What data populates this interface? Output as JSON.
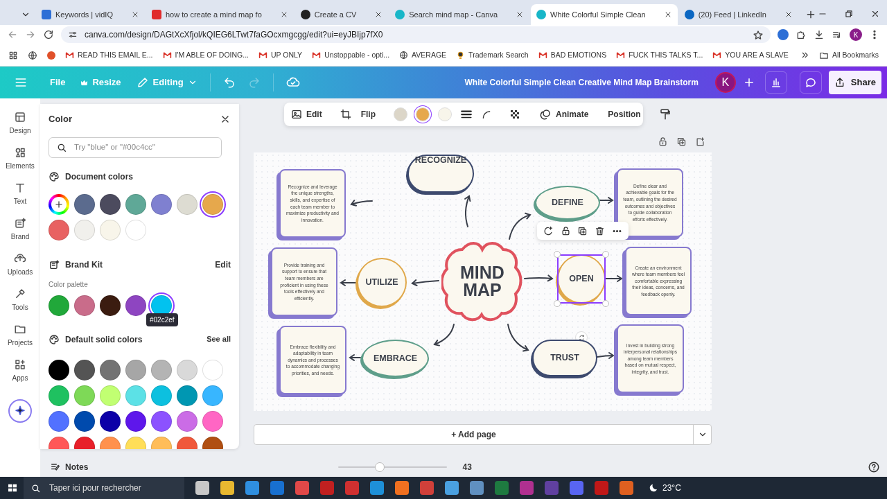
{
  "browser": {
    "tabs": [
      {
        "title": "Keywords | vidIQ",
        "selected": false
      },
      {
        "title": "how to create a mind map fo",
        "selected": false
      },
      {
        "title": "Create a CV",
        "selected": false
      },
      {
        "title": "Search mind map - Canva",
        "selected": false
      },
      {
        "title": "White Colorful Simple Clean",
        "selected": true
      },
      {
        "title": "(20) Feed | LinkedIn",
        "selected": false
      }
    ],
    "address": "canva.com/design/DAGtXcXfjol/kQIEG6LTwt7faGOcxmgcgg/edit?ui=eyJBIjp7fX0",
    "profile": "K",
    "bookmarks": [
      {
        "label": "READ THIS EMAIL E...",
        "kind": "mail"
      },
      {
        "label": "I'M ABLE OF DOING...",
        "kind": "mail"
      },
      {
        "label": "UP ONLY",
        "kind": "mail"
      },
      {
        "label": "Unstoppable - opti...",
        "kind": "mail"
      },
      {
        "label": "AVERAGE",
        "kind": "globe"
      },
      {
        "label": "Trademark Search",
        "kind": "bulb"
      },
      {
        "label": "BAD EMOTIONS",
        "kind": "mail"
      },
      {
        "label": "FUCK THIS TALKS T...",
        "kind": "mail"
      },
      {
        "label": "YOU ARE A SLAVE",
        "kind": "mail"
      }
    ],
    "all_bookmarks": "All Bookmarks"
  },
  "header": {
    "menu": [
      {
        "label": "File",
        "kind": "text"
      },
      {
        "label": "Resize",
        "kind": "crown"
      },
      {
        "label": "Editing",
        "kind": "pencil"
      }
    ],
    "redo_disabled": true,
    "title": "White Colorful Simple Clean Creative Mind Map Brainstorm",
    "avatar": "K",
    "share": "Share"
  },
  "sidebar": {
    "items": [
      {
        "label": "Design"
      },
      {
        "label": "Elements"
      },
      {
        "label": "Text"
      },
      {
        "label": "Brand"
      },
      {
        "label": "Uploads"
      },
      {
        "label": "Tools"
      },
      {
        "label": "Projects"
      },
      {
        "label": "Apps"
      }
    ]
  },
  "color_panel": {
    "title": "Color",
    "search": {
      "placeholder": "Try \"blue\" or \"#00c4cc\""
    },
    "document": {
      "title": "Document colors",
      "swatches": [
        {
          "color": "#5b6b8e",
          "selected": false
        },
        {
          "color": "#4c4b5e",
          "selected": false
        },
        {
          "color": "#5fa897",
          "selected": false
        },
        {
          "color": "#7f80d0",
          "selected": false
        },
        {
          "color": "#dddcd2",
          "selected": false
        },
        {
          "color": "#e6a84c",
          "selected": true
        },
        {
          "color": "#e86262",
          "selected": false
        },
        {
          "color": "#f1f0ec",
          "selected": false
        },
        {
          "color": "#f8f5ea",
          "selected": false
        },
        {
          "color": "#ffffff",
          "selected": false
        }
      ]
    },
    "brand": {
      "title": "Brand Kit",
      "edit": "Edit",
      "subtitle": "Color palette",
      "tooltip": "#02c2ef",
      "swatches": [
        {
          "color": "#21a83a",
          "selected": false
        },
        {
          "color": "#c96c8a",
          "selected": false
        },
        {
          "color": "#3b1c10",
          "selected": false
        },
        {
          "color": "#8e45c1",
          "selected": false
        },
        {
          "color": "#02c2ef",
          "selected": true
        }
      ]
    },
    "defaults": {
      "title": "Default solid colors",
      "see_all": "See all",
      "swatches": [
        {
          "color": "#000000",
          "selected": false
        },
        {
          "color": "#545454",
          "selected": false
        },
        {
          "color": "#737373",
          "selected": false
        },
        {
          "color": "#a6a6a6",
          "selected": false
        },
        {
          "color": "#b4b4b4",
          "selected": false
        },
        {
          "color": "#d9d9d9",
          "selected": false
        },
        {
          "color": "#ffffff",
          "selected": false
        },
        {
          "color": "#1fc160",
          "selected": false
        },
        {
          "color": "#7ed957",
          "selected": false
        },
        {
          "color": "#c1ff72",
          "selected": false
        },
        {
          "color": "#5ce1e6",
          "selected": false
        },
        {
          "color": "#0cc0df",
          "selected": false
        },
        {
          "color": "#0097b2",
          "selected": false
        },
        {
          "color": "#38b6ff",
          "selected": false
        },
        {
          "color": "#5271ff",
          "selected": false
        },
        {
          "color": "#004aad",
          "selected": false
        },
        {
          "color": "#0c00a8",
          "selected": false
        },
        {
          "color": "#5e17eb",
          "selected": false
        },
        {
          "color": "#8c52ff",
          "selected": false
        },
        {
          "color": "#cb6ce6",
          "selected": false
        },
        {
          "color": "#ff66c4",
          "selected": false
        },
        {
          "color": "#ff5757",
          "selected": false
        },
        {
          "color": "#e8202a",
          "selected": false
        },
        {
          "color": "#ff914d",
          "selected": false
        },
        {
          "color": "#ffde59",
          "selected": false
        },
        {
          "color": "#ffbd59",
          "selected": false
        },
        {
          "color": "#f0583a",
          "selected": false
        },
        {
          "color": "#b04f12",
          "selected": false
        }
      ]
    }
  },
  "toolbar": {
    "edit": "Edit",
    "flip": "Flip",
    "swatches": [
      {
        "color": "#dcd6c8",
        "selected": false
      },
      {
        "color": "#e6a84c",
        "selected": true
      },
      {
        "color": "#f8f5ea",
        "selected": false
      }
    ],
    "animate": "Animate",
    "position": "Position"
  },
  "mind_map": {
    "center": "MIND MAP",
    "branches": [
      {
        "label": "RECOGNIZE",
        "kind": "pill",
        "color": "#3d4a6e",
        "selected": false,
        "description": "Recognize and leverage the unique strengths, skills, and expertise of each team member to maximize productivity and innovation."
      },
      {
        "label": "UTILIZE",
        "kind": "circle",
        "color": "#e0a84a",
        "selected": false,
        "description": "Provide training and support to ensure that team members are proficient in using these tools effectively and efficiently."
      },
      {
        "label": "EMBRACE",
        "kind": "ellipse",
        "color": "#5e9e8a",
        "selected": false,
        "description": "Embrace flexibility and adaptability in team dynamics and processes to accommodate changing priorities, and needs."
      },
      {
        "label": "DEFINE",
        "kind": "ellipse",
        "color": "#5e9e8a",
        "selected": false,
        "description": "Define clear and achievable goals for the team, outlining the desired outcomes and objectives to guide collaboration efforts effectively."
      },
      {
        "label": "OPEN",
        "kind": "circle",
        "color": "#e0a84a",
        "selected": true,
        "description": "Create an environment where team members feel comfortable expressing their ideas, concerns, and feedback openly."
      },
      {
        "label": "TRUST",
        "kind": "pill",
        "color": "#3d4a6e",
        "selected": false,
        "description": "Invest in building strong interpersonal relationships among team members based on mutual respect, integrity, and trust."
      }
    ]
  },
  "add_page": "+ Add page",
  "footer": {
    "notes": "Notes",
    "zoom": {
      "level": 0.38
    },
    "zoom_reading": "43"
  },
  "taskbar": {
    "search_placeholder": "Taper ici pour rechercher",
    "weather": "23°C"
  }
}
